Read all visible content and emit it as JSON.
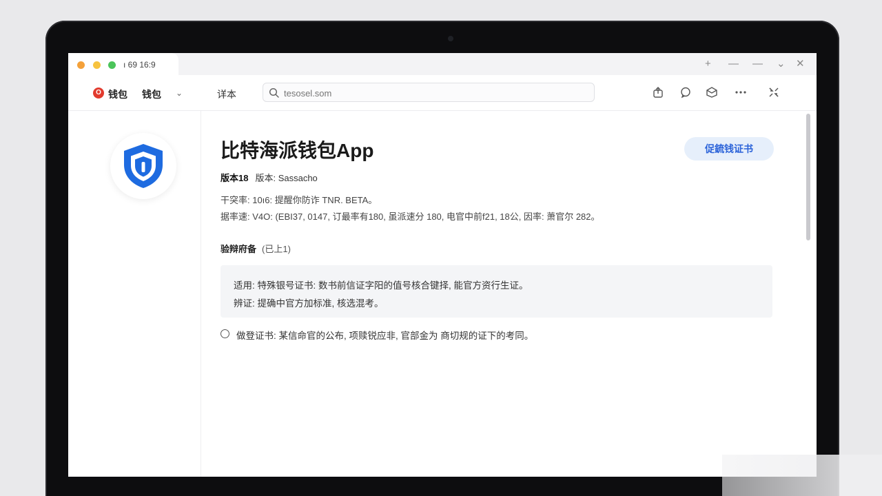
{
  "window": {
    "tab_title": "ı 69 16:9",
    "controls": [
      "+",
      "—",
      "—",
      "⌄",
      "✕"
    ]
  },
  "toolbar": {
    "brand_label": "钱包",
    "wallet_menu_label": "钱包",
    "detail_label": "详本",
    "search": {
      "placeholder": "tesosel.som",
      "value": ""
    }
  },
  "app": {
    "title": "比特海派钱包App",
    "cert_button_label": "促鋶钱证书",
    "version_label": "版本18",
    "version_value": "版本: Sassacho",
    "info_lines": [
      "干突率: 10ı6: 提醒你防诈 TNR. BETA。",
      "据率速: V4O: (EBI37, 0147, 订最率有180, 虽派速分 180, 电官中前f21, 18公, 因率: 萧官尔 282。"
    ]
  },
  "section": {
    "title": "验辩府备",
    "subtitle": "(已上1)"
  },
  "notice": {
    "lines": [
      "适用: 特殊银号证书: 数书前信证字阳的值号核合键择, 能官方资行生证。",
      "辨证: 提确中官方加标准, 核选混考。"
    ]
  },
  "option": {
    "label": "做登证书: 某信命官的公布, 项赎锐应非, 官部金为 商切规的证下的考同。"
  },
  "colors": {
    "accent": "#2b63d9",
    "shield": "#1e6be0",
    "button_bg": "#e6effb"
  },
  "icons": {
    "toolbar": [
      "share-icon",
      "chat-icon",
      "package-icon",
      "more-icon",
      "collapse-icon"
    ],
    "app": "shield-icon"
  }
}
